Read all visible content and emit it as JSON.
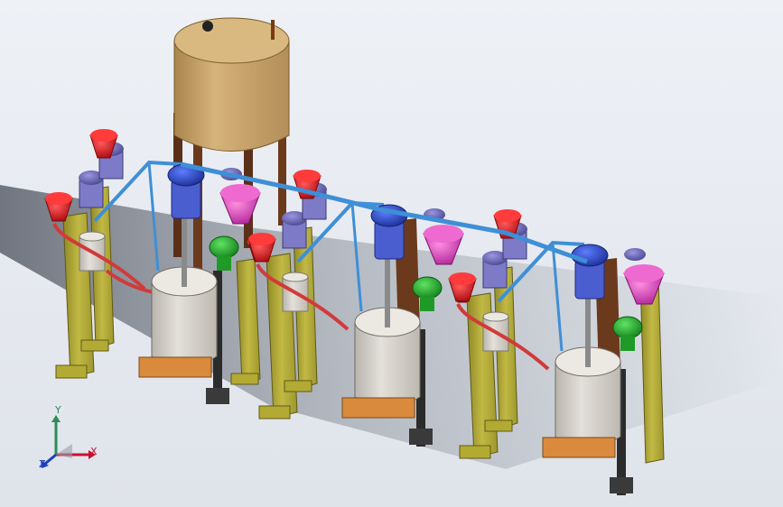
{
  "scene": {
    "kind": "cad-3d-assembly",
    "dosing_units": 3,
    "colors": {
      "background_light": "#eef1f6",
      "background_dark": "#c6ccd6",
      "shadow": "#7d848f",
      "tank_bronze": "#c8a369",
      "frame_olive": "#b6ad39",
      "frame_dark": "#6e6a20",
      "mix_tank_grey": "#d6d2ca",
      "post_brown": "#6b3a1c",
      "pipe_blue": "#3e8fd6",
      "pipe_red": "#d23a3a",
      "motor_blue": "#2847c9",
      "motor_purple": "#6d6ab8",
      "hopper_red": "#e01d24",
      "hopper_magenta": "#e64fc1",
      "pump_green": "#24b62b",
      "base_orange": "#d98a3c"
    },
    "icons": [
      "axis-triad-icon"
    ]
  },
  "triad": {
    "x_label": "X",
    "y_label": "Y",
    "z_label": "Z"
  }
}
